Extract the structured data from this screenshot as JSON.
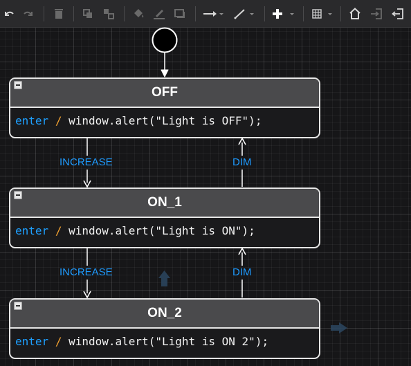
{
  "toolbar": {
    "buttons": [
      {
        "name": "undo-button",
        "icon": "undo-icon"
      },
      {
        "name": "redo-button",
        "icon": "redo-icon"
      },
      {
        "name": "delete-button",
        "icon": "trash-icon"
      },
      {
        "name": "group-button",
        "icon": "group-icon"
      },
      {
        "name": "ungroup-button",
        "icon": "ungroup-icon"
      },
      {
        "name": "fill-color-button",
        "icon": "paint-bucket-icon"
      },
      {
        "name": "line-color-button",
        "icon": "pen-line-icon"
      },
      {
        "name": "shadow-button",
        "icon": "shadow-box-icon"
      },
      {
        "name": "connection-style-button",
        "icon": "arrow-right-icon"
      },
      {
        "name": "waypoints-button",
        "icon": "diagonal-line-icon"
      },
      {
        "name": "insert-button",
        "icon": "plus-icon"
      },
      {
        "name": "table-button",
        "icon": "grid-table-icon"
      },
      {
        "name": "home-button",
        "icon": "home-icon"
      },
      {
        "name": "enter-group-button",
        "icon": "enter-icon"
      },
      {
        "name": "exit-group-button",
        "icon": "exit-icon"
      }
    ]
  },
  "colors": {
    "keyword": "#1ea0ff",
    "slash": "#f0a030",
    "transition_label": "#1e9bff",
    "header": "#4a4a4c"
  },
  "states": [
    {
      "name": "OFF",
      "keyword": "enter",
      "separator": "/",
      "action": "window.alert(\"Light is OFF\");"
    },
    {
      "name": "ON_1",
      "keyword": "enter",
      "separator": "/",
      "action": "window.alert(\"Light is ON\");"
    },
    {
      "name": "ON_2",
      "keyword": "enter",
      "separator": "/",
      "action": "window.alert(\"Light is ON 2\");"
    }
  ],
  "transitions": [
    {
      "from": "OFF",
      "to": "ON_1",
      "label": "INCREASE"
    },
    {
      "from": "ON_1",
      "to": "OFF",
      "label": "DIM"
    },
    {
      "from": "ON_1",
      "to": "ON_2",
      "label": "INCREASE"
    },
    {
      "from": "ON_2",
      "to": "ON_1",
      "label": "DIM"
    }
  ]
}
